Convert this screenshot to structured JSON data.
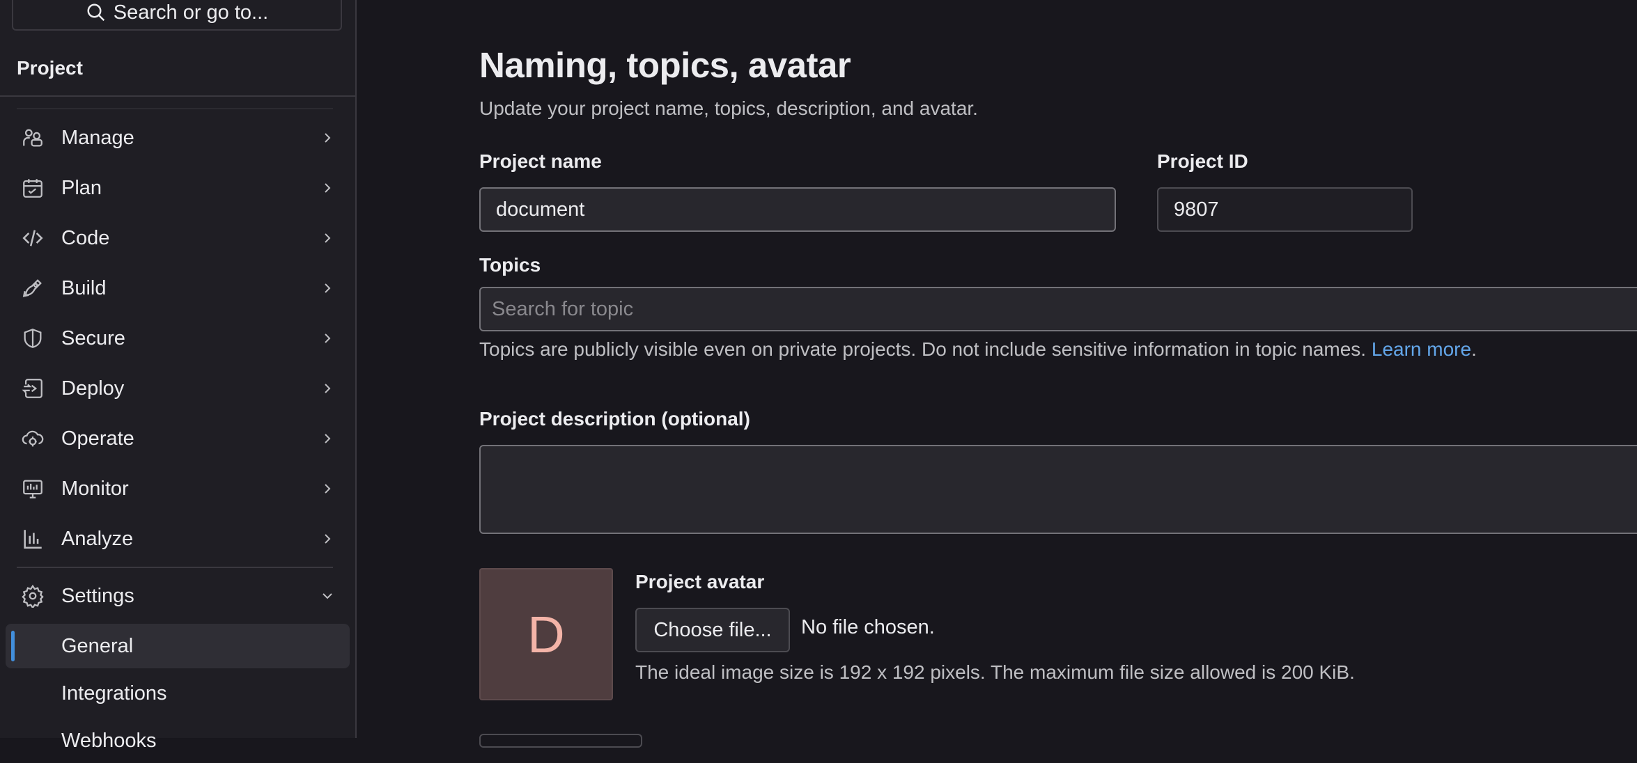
{
  "sidebar": {
    "search_label": "Search or go to...",
    "section_title": "Project",
    "items": [
      {
        "label": "Manage",
        "icon": "users-icon"
      },
      {
        "label": "Plan",
        "icon": "calendar-icon"
      },
      {
        "label": "Code",
        "icon": "code-icon"
      },
      {
        "label": "Build",
        "icon": "rocket-icon"
      },
      {
        "label": "Secure",
        "icon": "shield-icon"
      },
      {
        "label": "Deploy",
        "icon": "deploy-icon"
      },
      {
        "label": "Operate",
        "icon": "cloud-gear-icon"
      },
      {
        "label": "Monitor",
        "icon": "monitor-icon"
      },
      {
        "label": "Analyze",
        "icon": "chart-icon"
      }
    ],
    "settings": {
      "label": "Settings",
      "icon": "gear-icon"
    },
    "sub_items": [
      {
        "label": "General",
        "active": true
      },
      {
        "label": "Integrations",
        "active": false
      },
      {
        "label": "Webhooks",
        "active": false
      }
    ],
    "accent_color": "#428fdc"
  },
  "main": {
    "title": "Naming, topics, avatar",
    "subtitle": "Update your project name, topics, description, and avatar.",
    "project_name": {
      "label": "Project name",
      "value": "document"
    },
    "project_id": {
      "label": "Project ID",
      "value": "9807"
    },
    "topics": {
      "label": "Topics",
      "placeholder": "Search for topic",
      "help_text": "Topics are publicly visible even on private projects. Do not include sensitive information in topic names.",
      "help_link": "Learn more",
      "help_end": "."
    },
    "description": {
      "label": "Project description (optional)",
      "value": ""
    },
    "avatar": {
      "label": "Project avatar",
      "initial": "D",
      "choose_button": "Choose file...",
      "file_status": "No file chosen.",
      "help": "The ideal image size is 192 x 192 pixels. The maximum file size allowed is 200 KiB."
    }
  }
}
